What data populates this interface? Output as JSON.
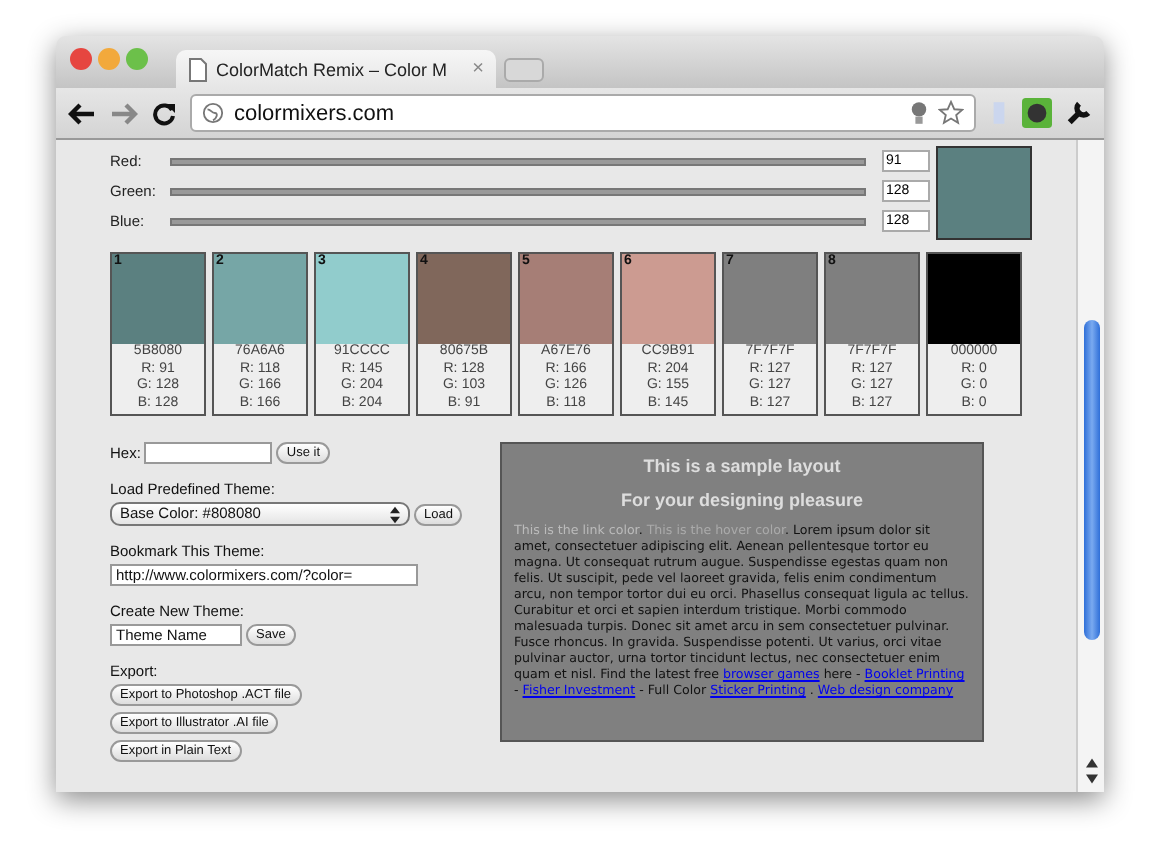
{
  "tab": {
    "title": "ColorMatch Remix – Color M",
    "close": "×"
  },
  "address": "colormixers.com",
  "sliders": [
    {
      "label": "Red:",
      "value": "91"
    },
    {
      "label": "Green:",
      "value": "128"
    },
    {
      "label": "Blue:",
      "value": "128"
    }
  ],
  "swatches": [
    {
      "number": "1",
      "color": "#5b8080",
      "hex": "5B8080",
      "r": "R: 91",
      "g": "G: 128",
      "b": "B: 128"
    },
    {
      "number": "2",
      "color": "#76a6a6",
      "hex": "76A6A6",
      "r": "R: 118",
      "g": "G: 166",
      "b": "B: 166"
    },
    {
      "number": "3",
      "color": "#91cccc",
      "hex": "91CCCC",
      "r": "R: 145",
      "g": "G: 204",
      "b": "B: 204"
    },
    {
      "number": "4",
      "color": "#80675b",
      "hex": "80675B",
      "r": "R: 128",
      "g": "G: 103",
      "b": "B: 91"
    },
    {
      "number": "5",
      "color": "#a67e76",
      "hex": "A67E76",
      "r": "R: 166",
      "g": "G: 126",
      "b": "B: 118"
    },
    {
      "number": "6",
      "color": "#cc9b91",
      "hex": "CC9B91",
      "r": "R: 204",
      "g": "G: 155",
      "b": "B: 145"
    },
    {
      "number": "7",
      "color": "#7f7f7f",
      "hex": "7F7F7F",
      "r": "R: 127",
      "g": "G: 127",
      "b": "B: 127"
    },
    {
      "number": "8",
      "color": "#7f7f7f",
      "hex": "7F7F7F",
      "r": "R: 127",
      "g": "G: 127",
      "b": "B: 127"
    },
    {
      "color": "#000000",
      "hex": "000000",
      "r": "R: 0",
      "g": "G: 0",
      "b": "B: 0"
    }
  ],
  "form": {
    "hex_label": "Hex:",
    "use_button": "Use it",
    "load_label": "Load Predefined Theme:",
    "theme_select": "Base Color: #808080",
    "load_button": "Load",
    "bookmark_label": "Bookmark This Theme:",
    "bookmark_url": "http://www.colormixers.com/?color=",
    "create_label": "Create New Theme:",
    "theme_name": "Theme Name",
    "save_button": "Save",
    "export_label": "Export:",
    "export_buttons": [
      "Export to Photoshop .ACT file",
      "Export to Illustrator .AI file",
      "Export in Plain Text"
    ]
  },
  "sample": {
    "title": "This is a sample layout",
    "subtitle": "For your designing pleasure",
    "segments": [
      {
        "kind": "link-sample",
        "text": "This is the link color"
      },
      {
        "kind": "text",
        "text": ". "
      },
      {
        "kind": "hover-sample",
        "text": "This is the hover color"
      },
      {
        "kind": "text",
        "text": ". Lorem ipsum dolor sit amet, consectetuer adipiscing elit. Aenean pellentesque tortor eu magna. Ut consequat rutrum augue. Suspendisse egestas quam non felis. Ut suscipit, pede vel laoreet gravida, felis enim condimentum arcu, non tempor tortor dui eu orci. Phasellus consequat ligula ac tellus. Curabitur et orci et sapien interdum tristique. Morbi commodo malesuada turpis. Donec sit amet arcu in sem consectetuer pulvinar. Fusce rhoncus. In gravida. Suspendisse potenti. Ut varius, orci vitae pulvinar auctor, urna tortor tincidunt lectus, nec consectetuer enim quam et nisl. Find the latest free "
      },
      {
        "kind": "link",
        "text": "browser games"
      },
      {
        "kind": "text",
        "text": " here - "
      },
      {
        "kind": "link",
        "text": "Booklet Printing"
      },
      {
        "kind": "text",
        "text": " - "
      },
      {
        "kind": "link",
        "text": "Fisher Investment"
      },
      {
        "kind": "text",
        "text": " - Full Color "
      },
      {
        "kind": "link",
        "text": "Sticker Printing"
      },
      {
        "kind": "text",
        "text": " . "
      },
      {
        "kind": "link",
        "text": "Web design company"
      }
    ]
  }
}
